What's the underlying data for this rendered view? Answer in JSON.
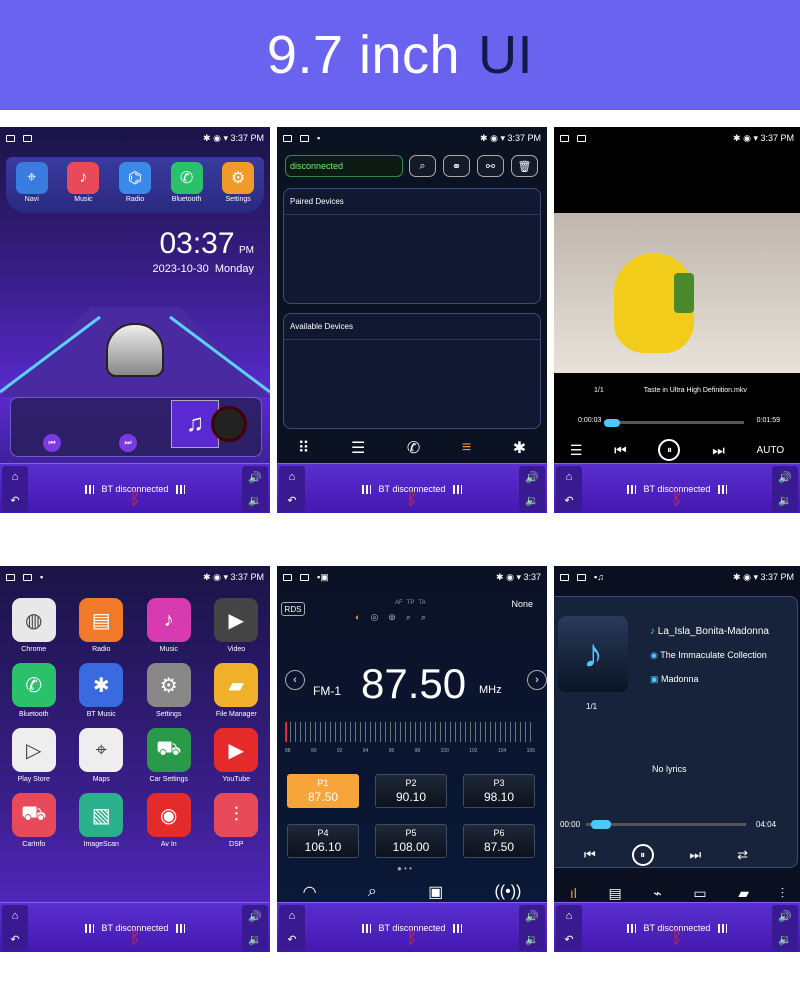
{
  "banner": {
    "size": "9.7 inch",
    "ui": "UI"
  },
  "status": {
    "time": "3:37 PM",
    "time_short": "3:37"
  },
  "bottom": {
    "bt_text": "BT disconnected"
  },
  "home": {
    "apps": [
      "Navi",
      "Music",
      "Radio",
      "Bluetooth",
      "Settings"
    ],
    "clock": "03:37",
    "ampm": "PM",
    "date": "2023-10-30",
    "weekday": "Monday"
  },
  "bluetooth": {
    "status": "disconnected",
    "paired": "Paired Devices",
    "available": "Available Devices"
  },
  "video": {
    "index": "1/1",
    "file": "Taste in Ultra High Definition.mkv",
    "elapsed": "0:00:03",
    "total": "0:01:59",
    "mode": "AUTO"
  },
  "apps": {
    "items": [
      "Chrome",
      "Radio",
      "Music",
      "Video",
      "Bluetooth",
      "BT Music",
      "Settings",
      "File Manager",
      "Play Store",
      "Maps",
      "Car Settings",
      "YouTube",
      "CarInfo",
      "ImageScan",
      "Av In",
      "DSP"
    ]
  },
  "radio": {
    "rds": "RDS",
    "flags": [
      "AF",
      "TP",
      "TA"
    ],
    "pty": "None",
    "band": "FM-1",
    "freq": "87.50",
    "unit": "MHz",
    "scale": [
      "88",
      "90",
      "92",
      "94",
      "96",
      "98",
      "100",
      "102",
      "104",
      "106"
    ],
    "presets": [
      {
        "n": "P1",
        "f": "87.50"
      },
      {
        "n": "P2",
        "f": "90.10"
      },
      {
        "n": "P3",
        "f": "98.10"
      },
      {
        "n": "P4",
        "f": "106.10"
      },
      {
        "n": "P5",
        "f": "108.00"
      },
      {
        "n": "P6",
        "f": "87.50"
      }
    ]
  },
  "music": {
    "title": "La_Isla_Bonita-Madonna",
    "album": "The Immaculate Collection",
    "artist": "Madonna",
    "index": "1/1",
    "lyrics": "No lyrics",
    "elapsed": "00:00",
    "total": "04:04",
    "progress": 0.03
  },
  "colors": {
    "accent": "#6a63f0",
    "bar": "#4418b0",
    "preset": "#f7a43b"
  }
}
